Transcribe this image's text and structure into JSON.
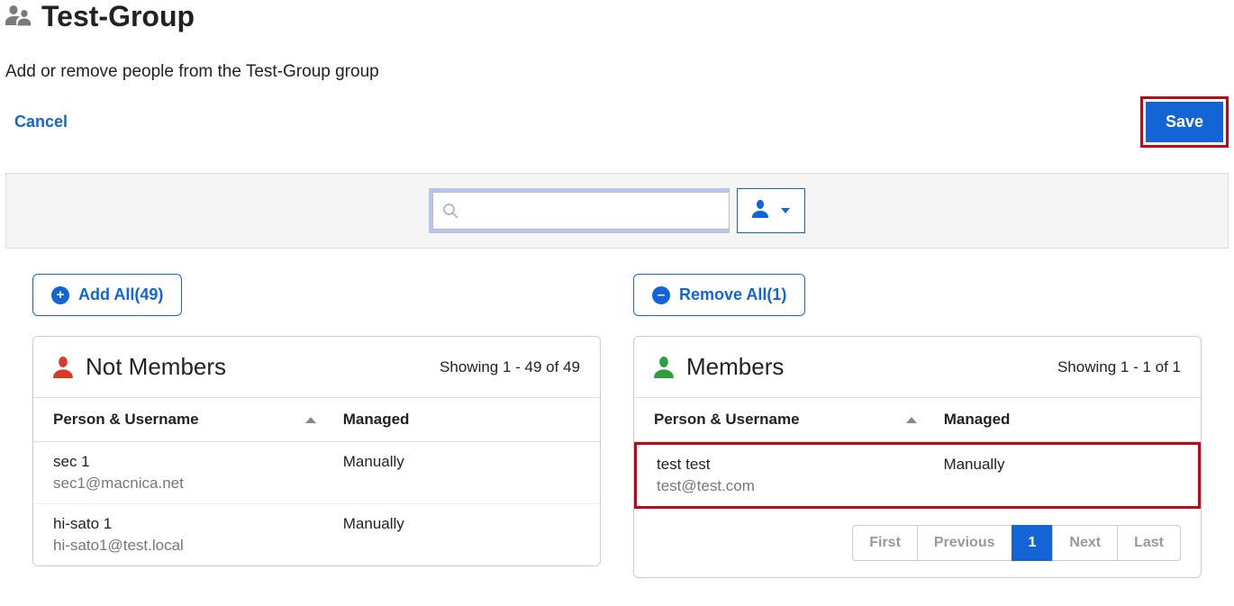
{
  "header": {
    "title": "Test-Group",
    "subtitle": "Add or remove people from the Test-Group group",
    "cancel": "Cancel",
    "save": "Save"
  },
  "search": {
    "value": ""
  },
  "nonMembers": {
    "bulkLabel": "Add All(49)",
    "title": "Not Members",
    "range": "Showing 1 - 49 of 49",
    "col1": "Person & Username",
    "col2": "Managed",
    "rows": [
      {
        "name": "sec 1",
        "user": "sec1@macnica.net",
        "managed": "Manually"
      },
      {
        "name": "hi-sato 1",
        "user": "hi-sato1@test.local",
        "managed": "Manually"
      }
    ]
  },
  "members": {
    "bulkLabel": "Remove All(1)",
    "title": "Members",
    "range": "Showing 1 - 1 of 1",
    "col1": "Person & Username",
    "col2": "Managed",
    "rows": [
      {
        "name": "test test",
        "user": "test@test.com",
        "managed": "Manually"
      }
    ],
    "pager": {
      "first": "First",
      "prev": "Previous",
      "page": "1",
      "next": "Next",
      "last": "Last"
    }
  }
}
